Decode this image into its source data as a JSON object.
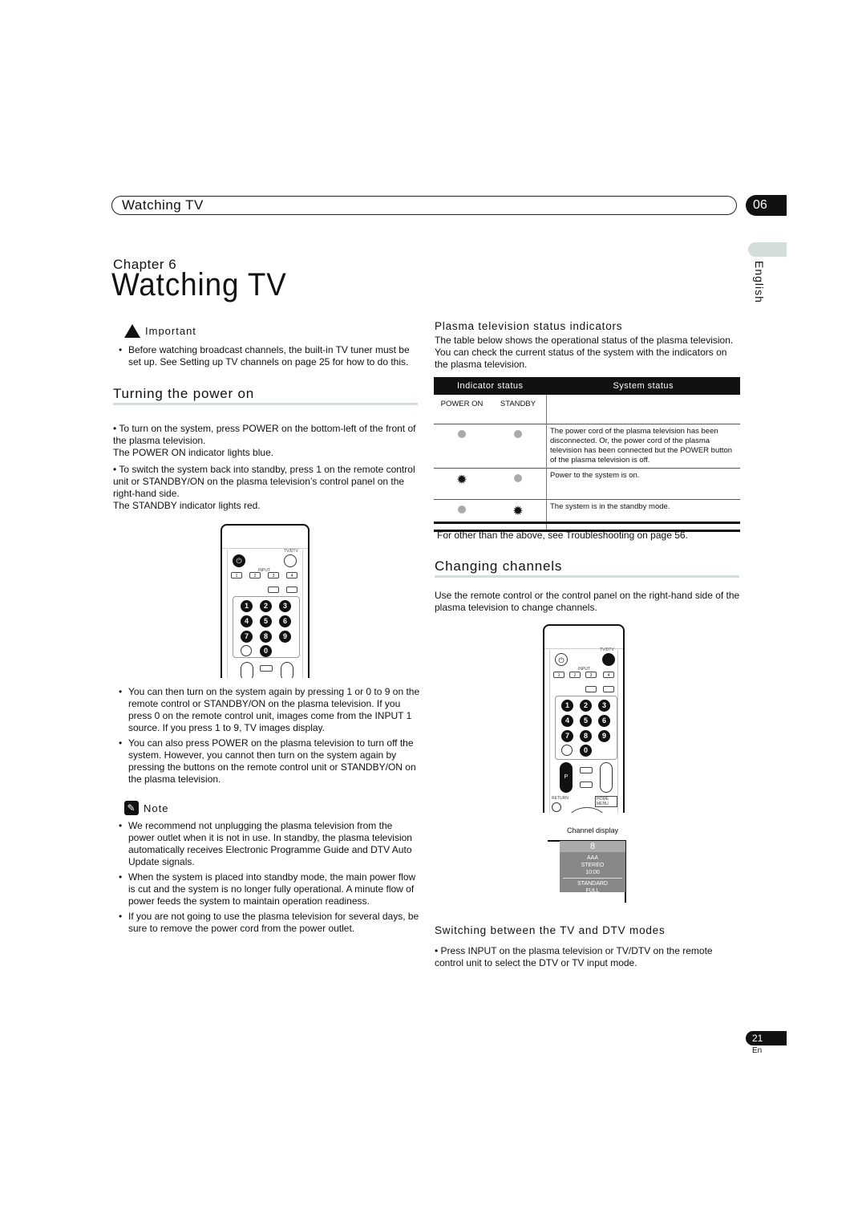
{
  "header": {
    "title": "Watching TV",
    "chapter_number": "06"
  },
  "language_tab": "English",
  "chapter_label": "Chapter 6",
  "page_title": "Watching TV",
  "important": {
    "label": "Important",
    "items": [
      "Before watching broadcast channels, the built-in TV tuner must be set up. See Setting up TV channels on page 25 for how to do this."
    ]
  },
  "turning_power_on": {
    "title": "Turning the power on",
    "step1": "•   To turn on the system, press POWER on the bottom-left of the front of the plasma television.",
    "step1_result": "The POWER ON indicator lights blue.",
    "step2": "•   To switch the system back into standby, press  1 on the remote control unit or STANDBY/ON on the plasma television’s control panel on the right-hand side.",
    "step2_result": "The STANDBY indicator lights red.",
    "notes": [
      "You can then turn on the system again by pressing  1 or 0 to 9 on the remote control or STANDBY/ON on the plasma television. If you press 0 on the remote control unit, images come from the INPUT 1 source. If you press 1 to 9, TV images display.",
      "You can also press POWER on the plasma television to turn off the system. However, you cannot then turn on the system again by pressing the buttons on the remote control unit or STANDBY/ON on the plasma television."
    ]
  },
  "note": {
    "label": "Note",
    "items": [
      "We recommend not unplugging the plasma television from the power outlet when it is not in use. In standby, the plasma television automatically receives Electronic Programme Guide and DTV Auto Update signals.",
      "When the system is placed into standby mode, the main power flow is cut and the system is no longer fully operational. A minute flow of power feeds the system to maintain operation readiness.",
      "If you are not going to use the plasma television for several days, be sure to remove the power cord from the power outlet."
    ]
  },
  "remote": {
    "tv_dtv": "TV/DTV",
    "input_label": "INPUT",
    "inputs": [
      "1",
      "2",
      "3",
      "4"
    ],
    "digits": [
      "1",
      "2",
      "3",
      "4",
      "5",
      "6",
      "7",
      "8",
      "9",
      "0"
    ],
    "p_label": "P",
    "return_label": "RETURN",
    "home_menu_label": "HOME MENU"
  },
  "status_indicators": {
    "title": "Plasma television status indicators",
    "intro": "The table below shows the operational status of the plasma television. You can check the current status of the system with the indicators on the plasma television.",
    "headers": {
      "indicator": "Indicator status",
      "system": "System status",
      "power_on": "POWER ON",
      "standby": "STANDBY"
    },
    "rows": [
      {
        "power_on": "off",
        "standby": "off",
        "system": "The power cord of the plasma television has been disconnected. Or, the power cord of the plasma television has been connected but the POWER button of the plasma television is off."
      },
      {
        "power_on": "lit",
        "standby": "off",
        "system": "Power to the system is on."
      },
      {
        "power_on": "off",
        "standby": "lit",
        "system": "The system is in the standby mode."
      }
    ],
    "footer": "For other than the above, see Troubleshooting on page 56."
  },
  "changing_channels": {
    "title": "Changing channels",
    "intro": "Use the remote control or the control panel on the right-hand side of the plasma television to change channels."
  },
  "channel_display": {
    "caption": "Channel display",
    "number": "8",
    "lines": [
      "AAA",
      "STEREO",
      "10:00"
    ],
    "lines2": [
      "STANDARD",
      "FULL"
    ]
  },
  "switching": {
    "title": "Switching between the TV and DTV modes",
    "text": "•   Press INPUT on the plasma television or TV/DTV on the remote control unit to select the DTV or TV input mode."
  },
  "footer": {
    "page_number": "21",
    "lang_code": "En"
  }
}
